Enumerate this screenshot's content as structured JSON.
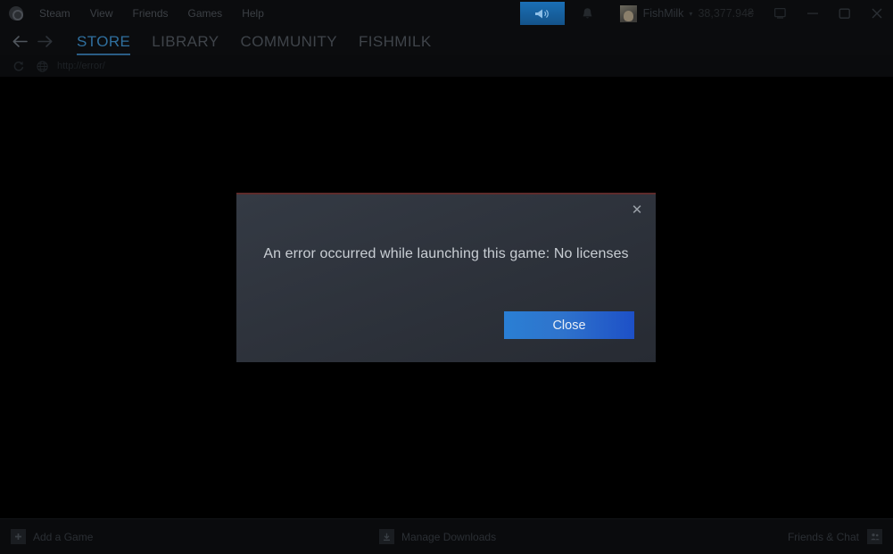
{
  "window": {
    "app_name": "Steam",
    "menu": [
      {
        "label": "Steam",
        "name": "menu-steam"
      },
      {
        "label": "View",
        "name": "menu-view"
      },
      {
        "label": "Friends",
        "name": "menu-friends"
      },
      {
        "label": "Games",
        "name": "menu-games"
      },
      {
        "label": "Help",
        "name": "menu-help"
      }
    ],
    "controls": {
      "broadcast_icon": "megaphone-icon",
      "notifications_icon": "bell-icon",
      "display_icon": "monitor-icon",
      "minimize_label": "–",
      "maximize_label": "□",
      "close_label": "✕"
    }
  },
  "user": {
    "name": "FishMilk",
    "caret": "▾",
    "balance": "38,377.94₴",
    "avatar_icon": "avatar"
  },
  "nav": {
    "back_icon": "arrow-left-icon",
    "forward_icon": "arrow-right-icon",
    "tabs": [
      {
        "label": "STORE",
        "active": true
      },
      {
        "label": "LIBRARY",
        "active": false
      },
      {
        "label": "COMMUNITY",
        "active": false
      },
      {
        "label": "FISHMILK",
        "active": false
      }
    ]
  },
  "urlbar": {
    "refresh_icon": "refresh-icon",
    "globe_icon": "globe-icon",
    "url": "http://error/"
  },
  "dialog": {
    "title_bar_accent": "#5e2b2b",
    "message": "An error occurred while launching this game: No licenses",
    "close_icon": "close-icon",
    "primary_button": "Close",
    "primary_button_color": "#2a7fd4"
  },
  "footer": {
    "add_game": {
      "label": "Add a Game",
      "icon": "plus-box-icon"
    },
    "manage_downloads": {
      "label": "Manage Downloads",
      "icon": "download-box-icon"
    },
    "friends_chat": {
      "label": "Friends & Chat",
      "icon": "friends-box-icon"
    }
  }
}
